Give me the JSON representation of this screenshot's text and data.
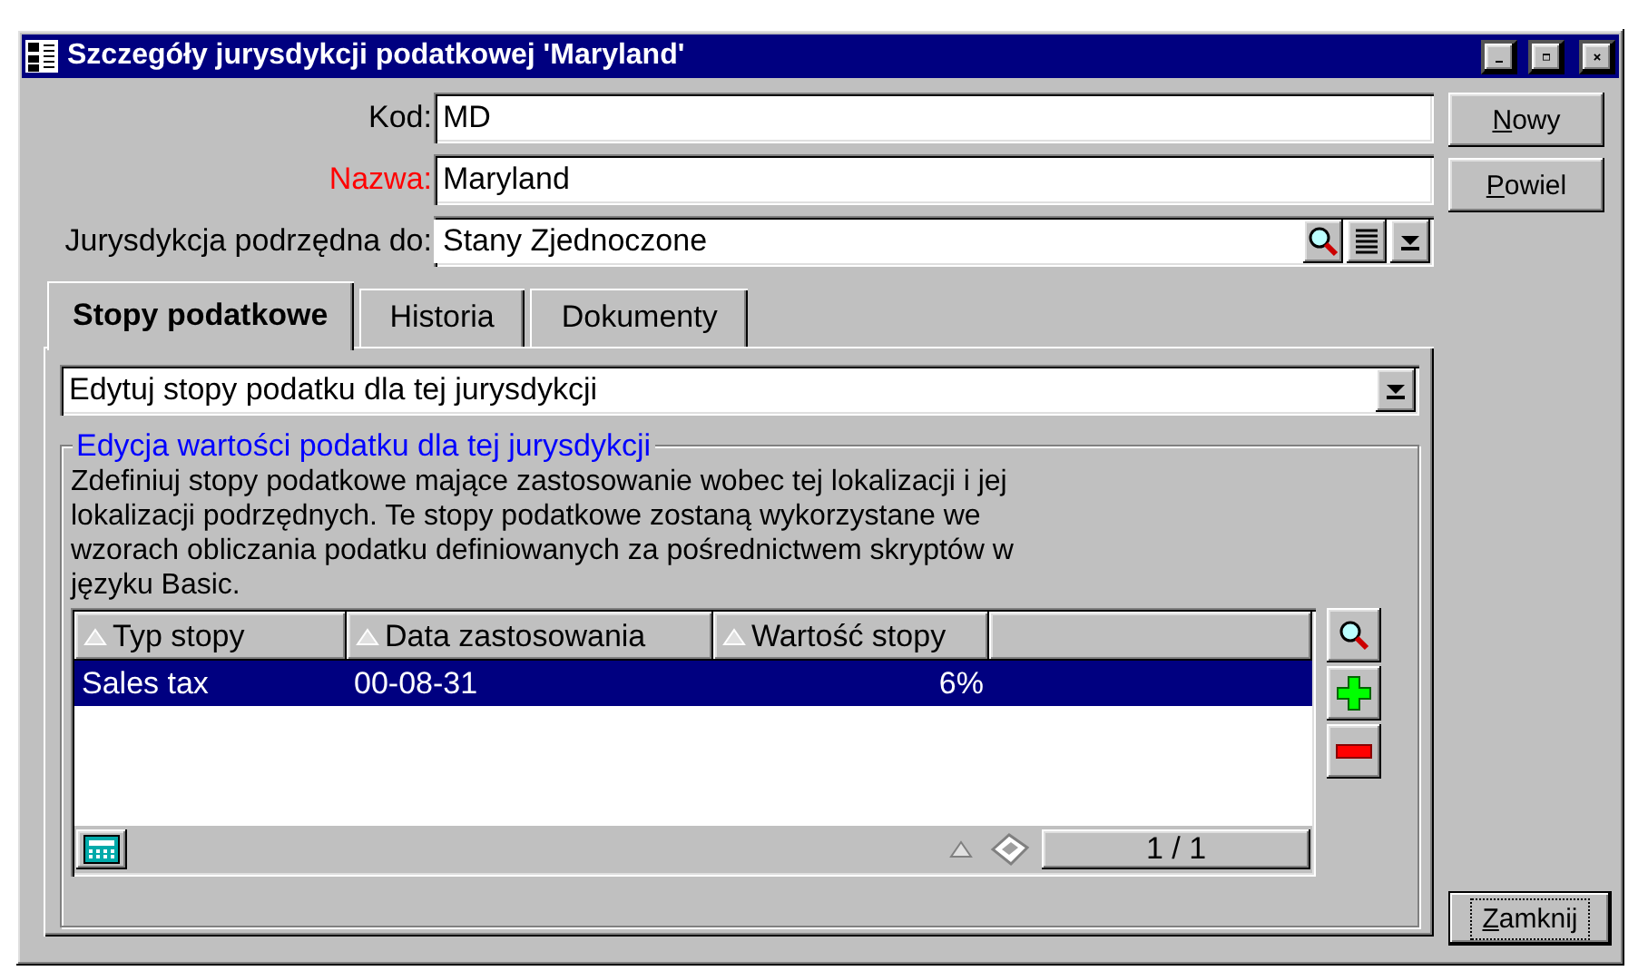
{
  "window": {
    "title": "Szczegóły jurysdykcji podatkowej 'Maryland'"
  },
  "fields": [
    {
      "label": "Kod:",
      "value": "MD",
      "required": false,
      "kind": "text"
    },
    {
      "label": "Nazwa:",
      "value": "Maryland",
      "required": true,
      "kind": "text"
    },
    {
      "label": "Jurysdykcja podrzędna do:",
      "value": "Stany Zjednoczone",
      "required": false,
      "kind": "lookup"
    }
  ],
  "side_buttons": [
    {
      "label": "Nowy"
    },
    {
      "label": "Powiel"
    }
  ],
  "tabs": [
    {
      "label": "Stopy podatkowe",
      "selected": true
    },
    {
      "label": "Historia",
      "selected": false
    },
    {
      "label": "Dokumenty",
      "selected": false
    }
  ],
  "action_dropdown": {
    "value": "Edytuj stopy podatku dla tej jurysdykcji"
  },
  "group": {
    "legend": "Edycja wartości podatku dla tej jurysdykcji",
    "description": "Zdefiniuj stopy podatkowe mające zastosowanie wobec tej lokalizacji i jej lokalizacji podrzędnych. Te stopy podatkowe zostaną wykorzystane we wzorach obliczania podatku definiowanych za pośrednictwem skryptów w języku Basic.",
    "table": {
      "columns": [
        "Typ stopy",
        "Data zastosowania",
        "Wartość stopy"
      ],
      "rows": [
        {
          "cells": [
            "Sales tax",
            "00-08-31",
            "6%"
          ],
          "selected": true
        }
      ],
      "pager": "1 / 1"
    }
  },
  "close_button": {
    "label": "Zamknij"
  }
}
